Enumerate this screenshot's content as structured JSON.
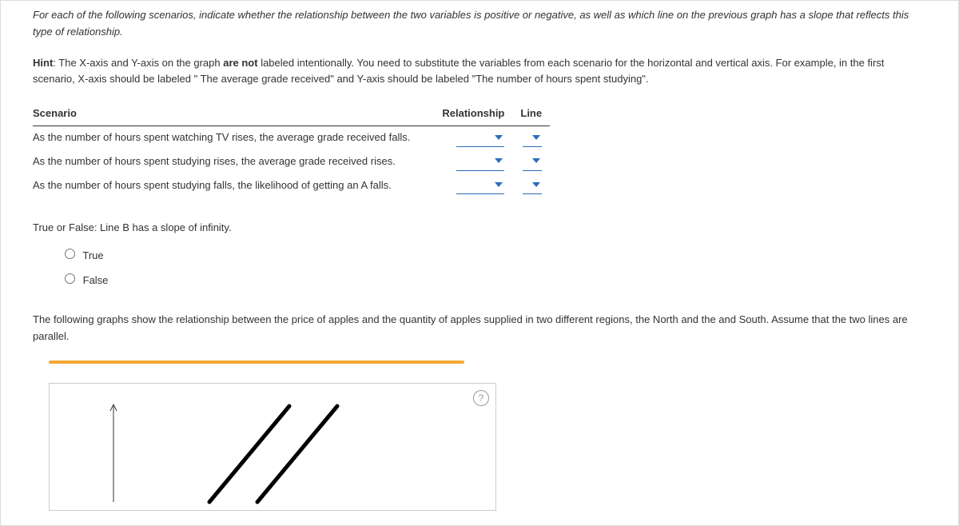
{
  "intro": "For each of the following scenarios, indicate whether the relationship between the two variables is positive or negative, as well as which line on the previous graph has a slope that reflects this type of relationship.",
  "hint": {
    "label": "Hint",
    "text_before_bold": ": The X-axis and Y-axis on the graph ",
    "bold": "are not",
    "text_after_bold": " labeled intentionally. You need to substitute the variables from each scenario for the horizontal and vertical axis. For example, in the first scenario, X-axis should be labeled \" The average grade received\" and Y-axis should be labeled \"The number of hours spent studying\"."
  },
  "table": {
    "headers": {
      "scenario": "Scenario",
      "relationship": "Relationship",
      "line": "Line"
    },
    "rows": [
      {
        "scenario": "As the number of hours spent watching TV rises, the average grade received falls."
      },
      {
        "scenario": "As the number of hours spent studying rises, the average grade received rises."
      },
      {
        "scenario": "As the number of hours spent studying falls, the likelihood of getting an A falls."
      }
    ]
  },
  "tf": {
    "question": "True or False: Line B has a slope of infinity.",
    "options": {
      "true": "True",
      "false": "False"
    }
  },
  "paragraph": "The following graphs show the relationship between the price of apples and the quantity of apples supplied in two different regions, the North and the and South. Assume that the two lines are parallel.",
  "help_icon": "?"
}
